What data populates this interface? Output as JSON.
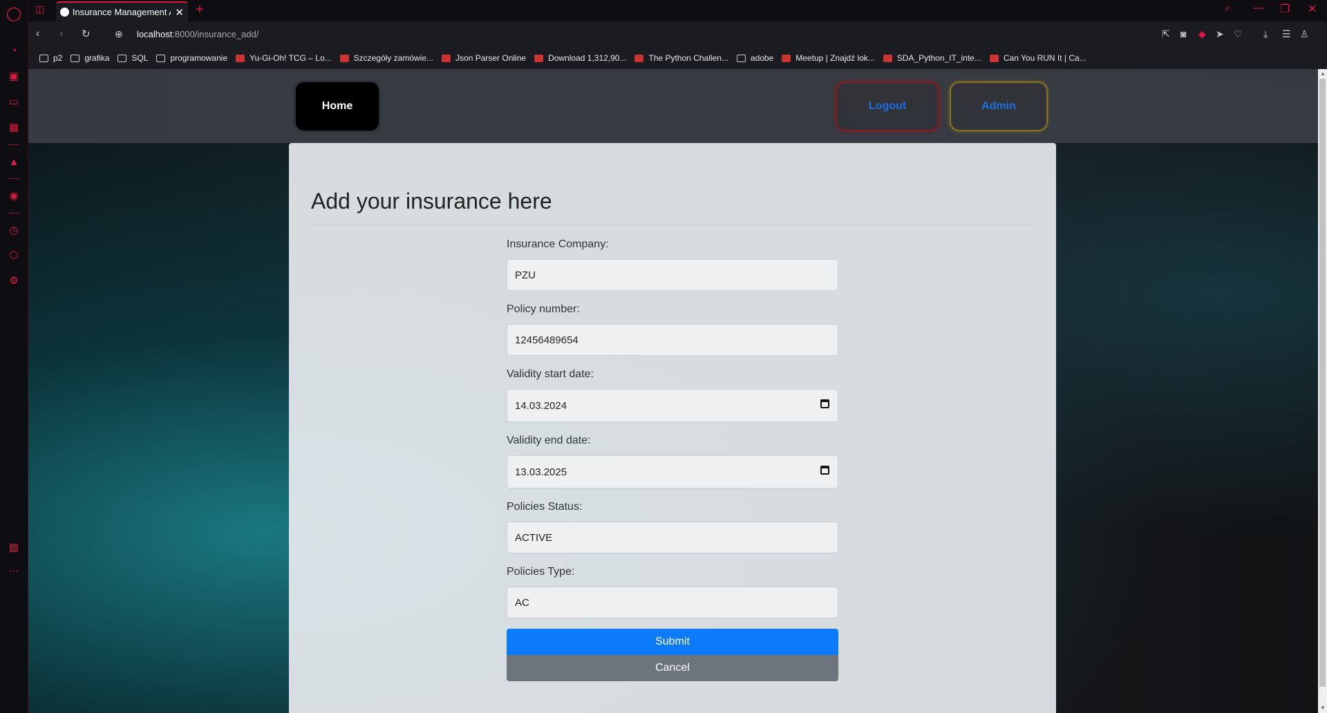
{
  "browser": {
    "tab_title": "Insurance Management Ap",
    "url_host": "localhost",
    "url_path": ":8000/insurance_add/",
    "bookmarks": [
      {
        "label": "p2",
        "icon": "folder-icon"
      },
      {
        "label": "grafika",
        "icon": "folder-icon"
      },
      {
        "label": "SQL",
        "icon": "folder-icon"
      },
      {
        "label": "programowanie",
        "icon": "folder-icon"
      },
      {
        "label": "Yu-Gi-Oh! TCG – Lo...",
        "icon": "site-favicon"
      },
      {
        "label": "Szczegóły zamówie...",
        "icon": "site-favicon"
      },
      {
        "label": "Json Parser Online",
        "icon": "site-favicon"
      },
      {
        "label": "Download 1,312,90...",
        "icon": "site-favicon"
      },
      {
        "label": "The Python Challen...",
        "icon": "site-favicon"
      },
      {
        "label": "adobe",
        "icon": "folder-icon"
      },
      {
        "label": "Meetup | Znajdź lok...",
        "icon": "site-favicon"
      },
      {
        "label": "SDA_Python_IT_inte...",
        "icon": "site-favicon"
      },
      {
        "label": "Can You RUN It | Ca...",
        "icon": "site-favicon"
      }
    ]
  },
  "nav": {
    "home": "Home",
    "logout": "Logout",
    "admin": "Admin"
  },
  "form": {
    "title": "Add your insurance here",
    "fields": [
      {
        "label": "Insurance Company:",
        "value": "PZU"
      },
      {
        "label": "Policy number:",
        "value": "12456489654"
      },
      {
        "label": "Validity start date:",
        "value": "14.03.2024"
      },
      {
        "label": "Validity end date:",
        "value": "13.03.2025"
      },
      {
        "label": "Policies Status:",
        "value": "ACTIVE"
      },
      {
        "label": "Policies Type:",
        "value": "AC"
      }
    ],
    "submit": "Submit",
    "cancel": "Cancel"
  },
  "colors": {
    "accent": "#e0193f",
    "submit": "#0b7bfa",
    "cancel": "#6c757d",
    "link": "#1d6fe0"
  }
}
